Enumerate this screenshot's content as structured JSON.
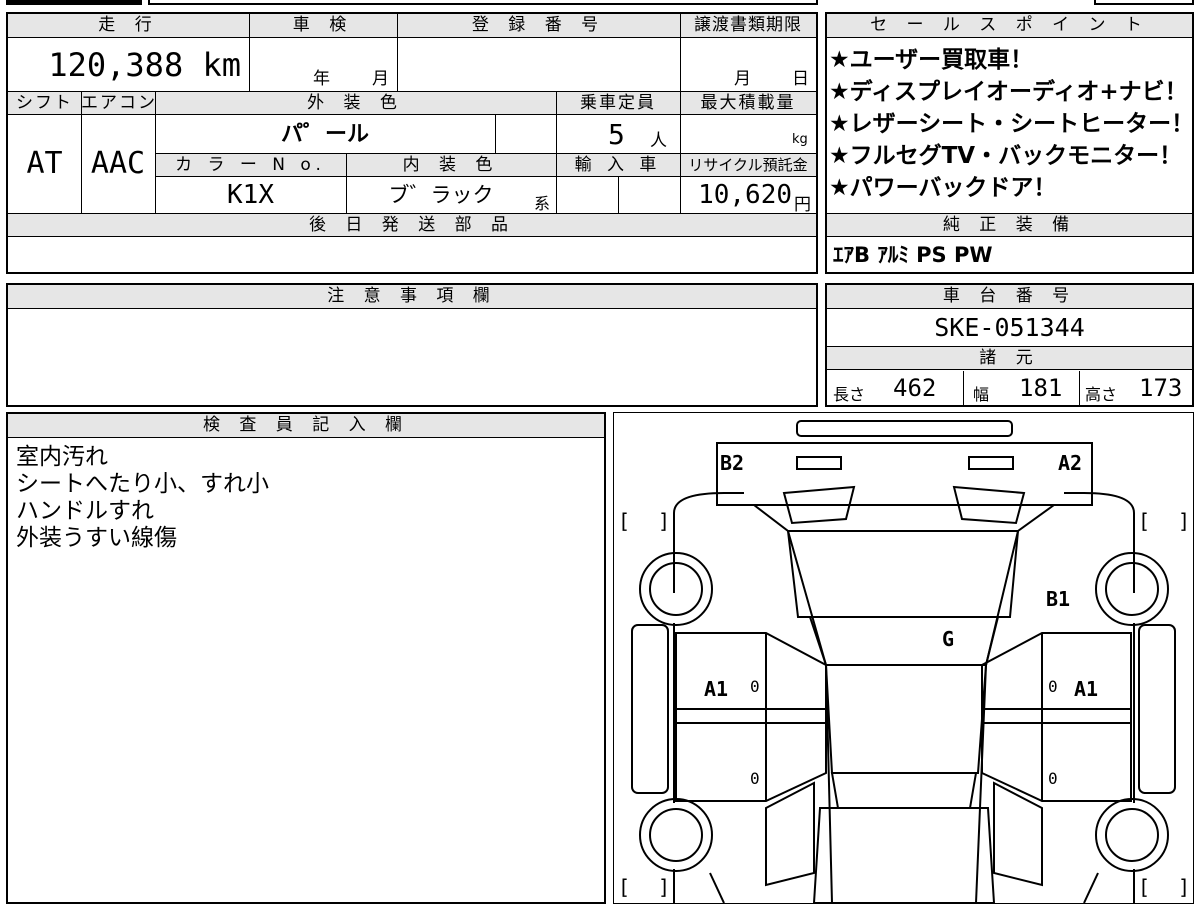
{
  "top": {
    "mileage_header": "走 行",
    "inspection_header": "車 検",
    "registration_header": "登 録 番 号",
    "transfer_header": "譲渡書類期限",
    "mileage": "120,388 km",
    "inspection_year": "年",
    "inspection_month": "月",
    "transfer_month": "月",
    "transfer_day": "日",
    "shift_header": "シフト",
    "aircon_header": "エアコン",
    "exterior_header": "外 装 色",
    "capacity_header": "乗車定員",
    "load_header": "最大積載量",
    "shift": "AT",
    "aircon": "AAC",
    "exterior_color": "パ゜ール",
    "capacity": "5",
    "capacity_unit": "人",
    "load_unit": "kg",
    "color_no_header": "カ ラ ー N o.",
    "interior_header": "内 装 色",
    "import_header": "輸 入 車",
    "recycle_header": "リサイクル預託金",
    "color_no": "K1X",
    "interior_color": "ブ゛ラック",
    "interior_suffix": "系",
    "recycle_fee": "10,620",
    "recycle_unit": "円",
    "later_parts_header": "後 日 発 送 部 品"
  },
  "sales": {
    "header": "セ ー ル ス ポ イ ン ト",
    "points": [
      "★ユーザー買取車！",
      "★ディスプレイオーディオ+ナビ！",
      "★レザーシート・シートヒーター！",
      "★フルセグTV・バックモニター！",
      "★パワーバックドア！"
    ]
  },
  "equipment": {
    "header": "純 正 装 備",
    "value": "ｴｱB ｱﾙﾐ PS PW"
  },
  "notes": {
    "header": "注 意 事 項 欄"
  },
  "chassis": {
    "header": "車 台 番 号",
    "number": "SKE-051344"
  },
  "specs": {
    "header": "諸 元",
    "length_label": "長さ",
    "length": "462",
    "width_label": "幅",
    "width": "181",
    "height_label": "高さ",
    "height": "173"
  },
  "inspector": {
    "header": "検 査 員 記 入 欄",
    "lines": [
      "室内汚れ",
      "シートへたり小、すれ小",
      "ハンドルすれ",
      "外装うすい線傷"
    ]
  },
  "diagram": {
    "b2": "B2",
    "a2": "A2",
    "b1": "B1",
    "g": "G",
    "a1_left": "A1",
    "a1_right": "A1",
    "zero": "0",
    "bracket_open": "[",
    "bracket_close": "]"
  }
}
